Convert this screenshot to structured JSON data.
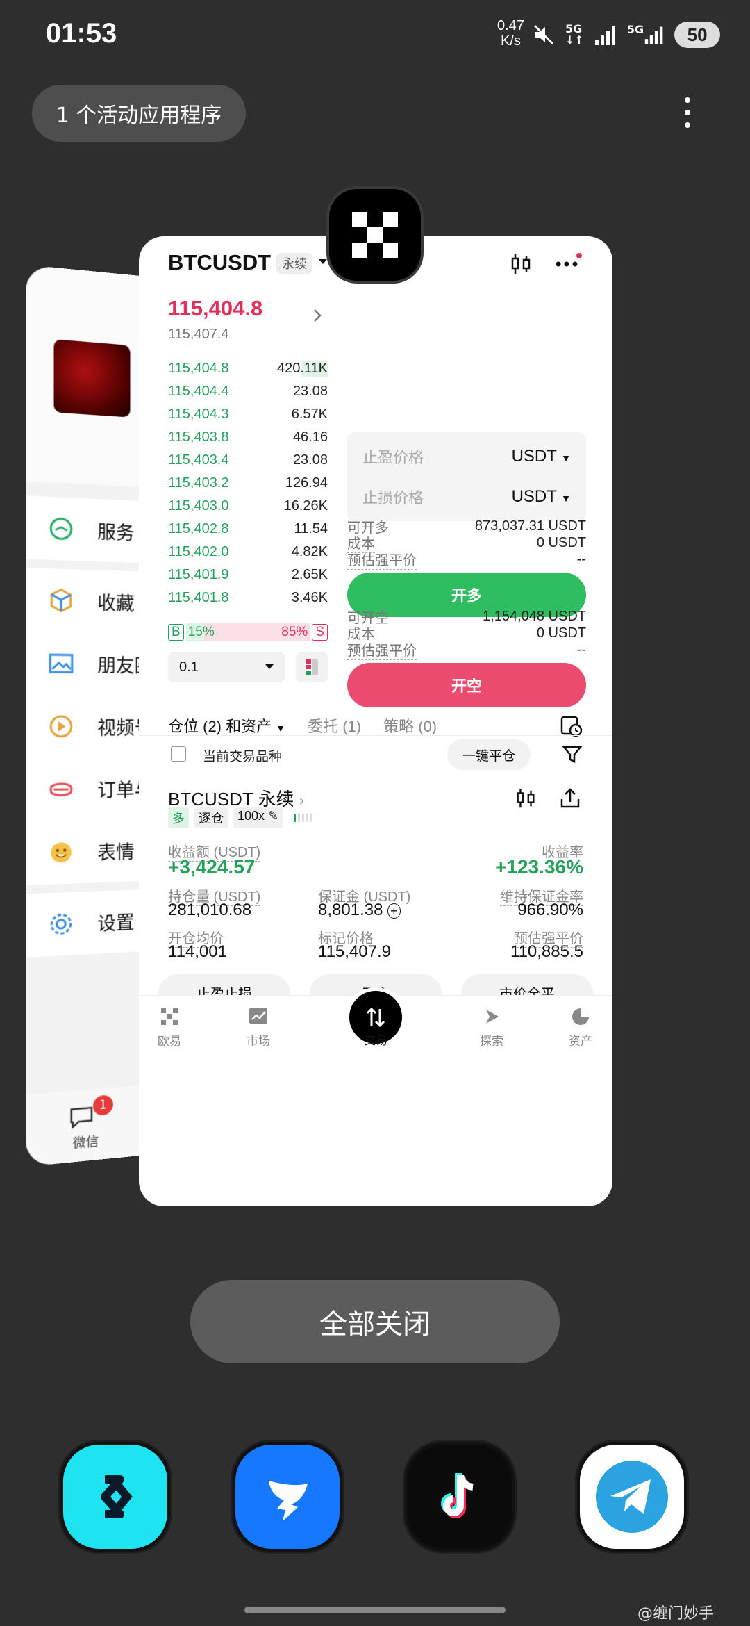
{
  "status_bar": {
    "time": "01:53",
    "net_speed_value": "0.47",
    "net_speed_unit": "K/s",
    "signal1": "5G",
    "signal2": "5G",
    "battery": "50"
  },
  "recents": {
    "active_apps_label": "1 个活动应用程序",
    "close_all": "全部关闭"
  },
  "wechat": {
    "items": [
      "服务",
      "收藏",
      "朋友圈",
      "视频号",
      "订单与",
      "表情",
      "设置"
    ],
    "nav_label": "微信",
    "badge": "1"
  },
  "okx": {
    "symbol": "BTCUSDT",
    "contract_tag": "永续",
    "last_price": "115,404.8",
    "mark_price": "115,407.4",
    "orderbook": [
      {
        "price": "115,404.8",
        "qty": "420.11K"
      },
      {
        "price": "115,404.4",
        "qty": "23.08"
      },
      {
        "price": "115,404.3",
        "qty": "6.57K"
      },
      {
        "price": "115,403.8",
        "qty": "46.16"
      },
      {
        "price": "115,403.4",
        "qty": "23.08"
      },
      {
        "price": "115,403.2",
        "qty": "126.94"
      },
      {
        "price": "115,403.0",
        "qty": "16.26K"
      },
      {
        "price": "115,402.8",
        "qty": "11.54"
      },
      {
        "price": "115,402.0",
        "qty": "4.82K"
      },
      {
        "price": "115,401.9",
        "qty": "2.65K"
      },
      {
        "price": "115,401.8",
        "qty": "3.46K"
      }
    ],
    "buy_ratio": {
      "label": "B",
      "value": "15%",
      "fraction": 0.15
    },
    "sell_ratio": {
      "label": "S",
      "value": "85%",
      "fraction": 0.85
    },
    "depth_step": "0.1",
    "tp_placeholder": "止盈价格",
    "sl_placeholder": "止损价格",
    "unit": "USDT",
    "long": {
      "avail_label": "可开多",
      "avail": "873,037.31 USDT",
      "cost_label": "成本",
      "cost": "0 USDT",
      "liq_label": "预估强平价",
      "liq": "--",
      "button": "开多"
    },
    "short": {
      "avail_label": "可开空",
      "avail": "1,154,048 USDT",
      "cost_label": "成本",
      "cost": "0 USDT",
      "liq_label": "预估强平价",
      "liq": "--",
      "button": "开空"
    },
    "tabs": [
      "仓位 (2) 和资产",
      "委托 (1)",
      "策略 (0)"
    ],
    "current_pair_label": "当前交易品种",
    "close_all_btn": "一键平仓",
    "position": {
      "title": "BTCUSDT 永续",
      "side": "多",
      "margin_mode": "逐仓",
      "leverage": "100x",
      "pnl_label": "收益额 (USDT)",
      "pnl": "+3,424.57",
      "roe_label": "收益率",
      "roe": "+123.36%",
      "size_label": "持仓量 (USDT)",
      "size": "281,010.68",
      "margin_label": "保证金 (USDT)",
      "margin": "8,801.38",
      "mmr_label": "维持保证金率",
      "mmr": "966.90%",
      "entry_label": "开仓均价",
      "entry": "114,001",
      "mark_label": "标记价格",
      "mark": "115,407.9",
      "liq_label": "预估强平价",
      "liq": "110,885.5",
      "actions": [
        "止盈止损",
        "平仓",
        "市价全平"
      ]
    },
    "nav": [
      "欧易",
      "市场",
      "交易",
      "探索",
      "资产"
    ]
  },
  "watermark": "@缠门妙手",
  "colors": {
    "up": "#25a25a",
    "down": "#e0305a",
    "long_btn": "#2ebd5f",
    "short_btn": "#ea4b6e"
  }
}
